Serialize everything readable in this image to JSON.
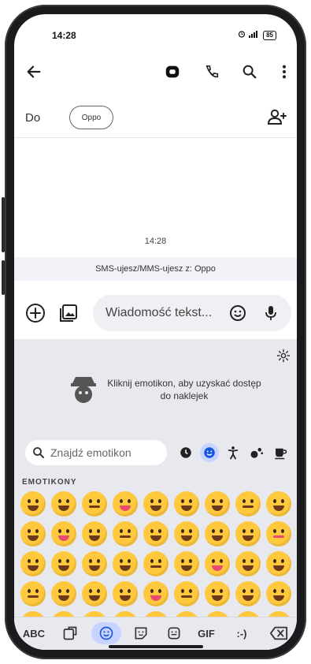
{
  "status_bar": {
    "time": "14:28",
    "signal": "signal-icon",
    "battery": "85"
  },
  "toolbar": {
    "back_icon": "arrow-left-icon",
    "video_icon": "video-message-icon",
    "call_icon": "phone-icon",
    "search_icon": "search-icon",
    "more_icon": "more-vert-icon"
  },
  "recipients": {
    "to_label": "Do",
    "chip_label": "Oppo",
    "add_icon": "add-person-icon"
  },
  "conversation": {
    "timestamp": "14:28",
    "sms_banner": "SMS-ujesz/MMS-ujesz z: Oppo"
  },
  "compose": {
    "placeholder": "Wiadomość tekst...",
    "add_icon": "add-circle-icon",
    "gallery_icon": "gallery-icon",
    "emoji_icon": "emoji-icon",
    "mic_icon": "mic-icon"
  },
  "keyboard": {
    "settings_icon": "gear-icon",
    "sticker_promo": "Kliknij emotikon, aby uzyskać dostęp do naklejek",
    "search_placeholder": "Znajdź emotikon",
    "categories": [
      "recent-icon",
      "emoji-smile-icon",
      "person-icon",
      "activity-icon",
      "food-icon"
    ],
    "section_label": "EMOTIKONY",
    "bar": {
      "abc": "ABC",
      "gif": "GIF",
      "emoticon": ":-)"
    },
    "emoji_colors": {
      "face": "#FFC83D",
      "accent": "#FF8A3D",
      "tongue": "#E84B6F"
    }
  }
}
